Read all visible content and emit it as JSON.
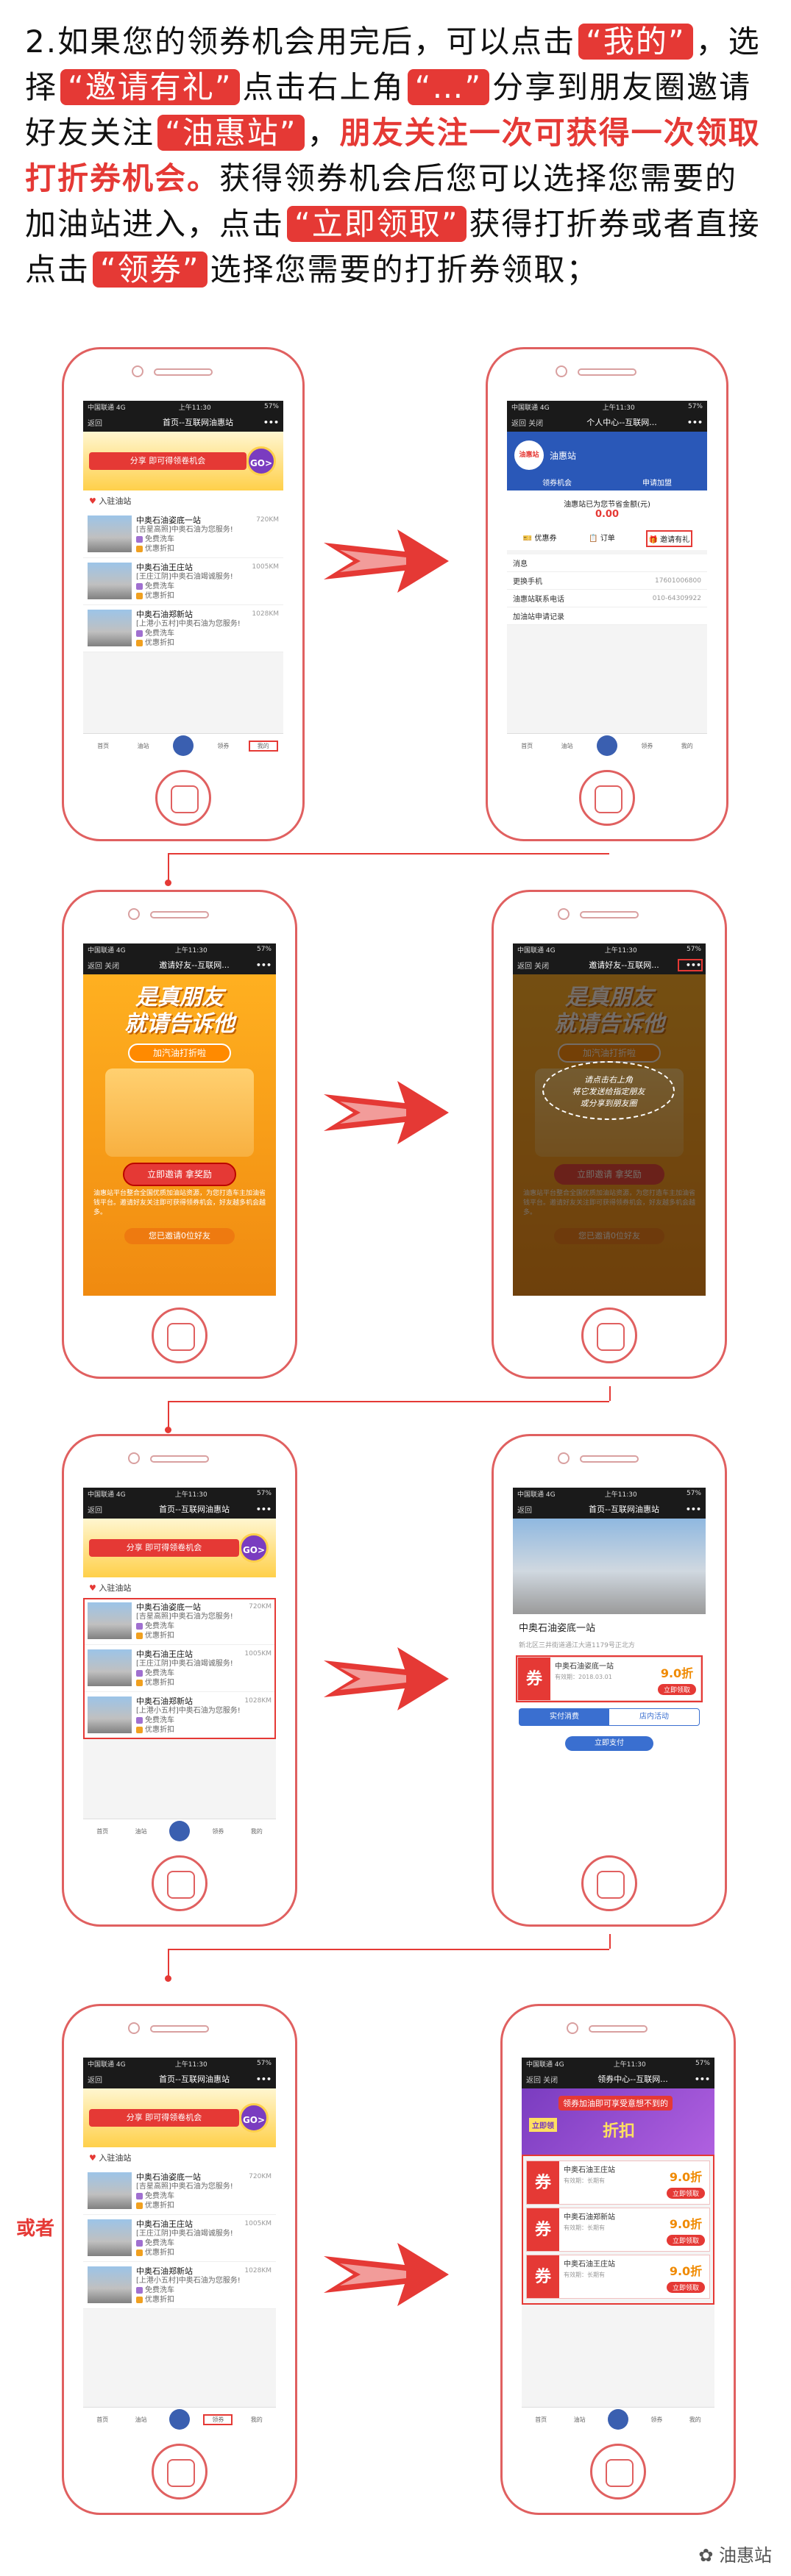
{
  "intro": {
    "p1": "2.如果您的领券机会用完后，可以点击",
    "tag_mine": "“我的”",
    "p2": "，选择",
    "tag_invite": "“邀请有礼”",
    "p3": "点击右上角",
    "tag_more": "“…”",
    "p4": "分享到朋友圈邀请好友关注",
    "tag_brand": "“油惠站”",
    "p5": "，",
    "red_text": "朋友关注一次可获得一次领取打折券机会。",
    "p6": "获得领券机会后您可以选择您需要的加油站进入，点击",
    "tag_claim": "“立即领取”",
    "p7": "获得打折券或者直接点击",
    "tag_coupon": "“领券”",
    "p8": "选择您需要的打折券领取；"
  },
  "home": {
    "status_left": "中国联通 4G",
    "status_time": "上午11:30",
    "status_right": "57%",
    "back": "返回",
    "title": "首页--互联网油惠站",
    "more": "•••",
    "banner_small": "超惠省 送新用优惠大礼包",
    "banner_text": "分享 即可得领卷机会",
    "go": "GO>",
    "section": "入驻油站",
    "stations": [
      {
        "name": "中奥石油姿底一站",
        "dist": "720KM",
        "addr": "[吉星高照]中奥石油为您服务!",
        "b1": "免费洗车",
        "b2": "优惠折扣"
      },
      {
        "name": "中奥石油王庄站",
        "dist": "1005KM",
        "addr": "[王庄江阴]中奥石油竭诚服务!",
        "b1": "免费洗车",
        "b2": "优惠折扣"
      },
      {
        "name": "中奥石油郑新站",
        "dist": "1028KM",
        "addr": "[上港小五村]中奥石油为您服务!",
        "b1": "免费洗车",
        "b2": "优惠折扣"
      }
    ],
    "tabs": [
      "首页",
      "油站",
      "",
      "领券",
      "我的"
    ]
  },
  "mine": {
    "title": "个人中心--互联网...",
    "back": "返回  关闭",
    "avatar": "油惠站",
    "username": "油惠站",
    "tab1": "领券机会",
    "tab2": "申请加盟",
    "saving": "油惠站已为您节省金额(元)",
    "amount": "0.00",
    "icons": [
      "优惠券",
      "订单",
      "邀请有礼"
    ],
    "rows": [
      {
        "k": "消息",
        "v": ""
      },
      {
        "k": "更换手机",
        "v": "17601006800"
      },
      {
        "k": "油惠站联系电话",
        "v": "010-64309922"
      },
      {
        "k": "加油站申请记录",
        "v": ""
      }
    ]
  },
  "invite": {
    "title": "邀请好友--互联网...",
    "back": "返回  关闭",
    "headline1": "是真朋友",
    "headline2": "就请告诉他",
    "pill": "加汽油打折啦",
    "button": "立即邀请  拿奖励",
    "desc": "油惠站平台整合全国优质加油站资源，为您打造车主加油省钱平台。邀请好友关注即可获得领券机会，好友越多机会越多。",
    "count": "您已邀请0位好友"
  },
  "share_tip": {
    "line1": "请点击右上角",
    "line2": "将它发送给指定朋友",
    "line3": "或分享到朋友圈"
  },
  "station": {
    "title": "首页--互联网油惠站",
    "name": "中奥石油姿底一站",
    "addr": "新北区三井街道通江大道1179号正北方",
    "coupon_name": "中奥石油姿底一站",
    "coupon_sub": "有效期：2018.03.01",
    "price": "9.0折",
    "get": "立即领取",
    "tab1": "实付消费",
    "tab2": "店内活动",
    "pay": "立即支付"
  },
  "coupons": {
    "title": "领券中心--互联网...",
    "back": "返回  关闭",
    "banner_a": "领券加油即可享受意想不到的",
    "banner_b": "折扣",
    "banner_c": "立即领",
    "list": [
      {
        "name": "中奥石油王庄站",
        "sub": "有效期：长期有",
        "price": "9.0折",
        "get": "立即领取"
      },
      {
        "name": "中奥石油郑新站",
        "sub": "有效期：长期有",
        "price": "9.0折",
        "get": "立即领取"
      },
      {
        "name": "中奥石油王庄站",
        "sub": "有效期：长期有",
        "price": "9.0折",
        "get": "立即领取"
      }
    ]
  },
  "glyphs": {
    "coupon": "券"
  },
  "or_text": "或者",
  "brand": "油惠站",
  "colors": {
    "accent": "#e53935",
    "nav_dark": "#1a1a1a",
    "invite_orange": "#ffa020",
    "profile_blue": "#2a58b8"
  }
}
